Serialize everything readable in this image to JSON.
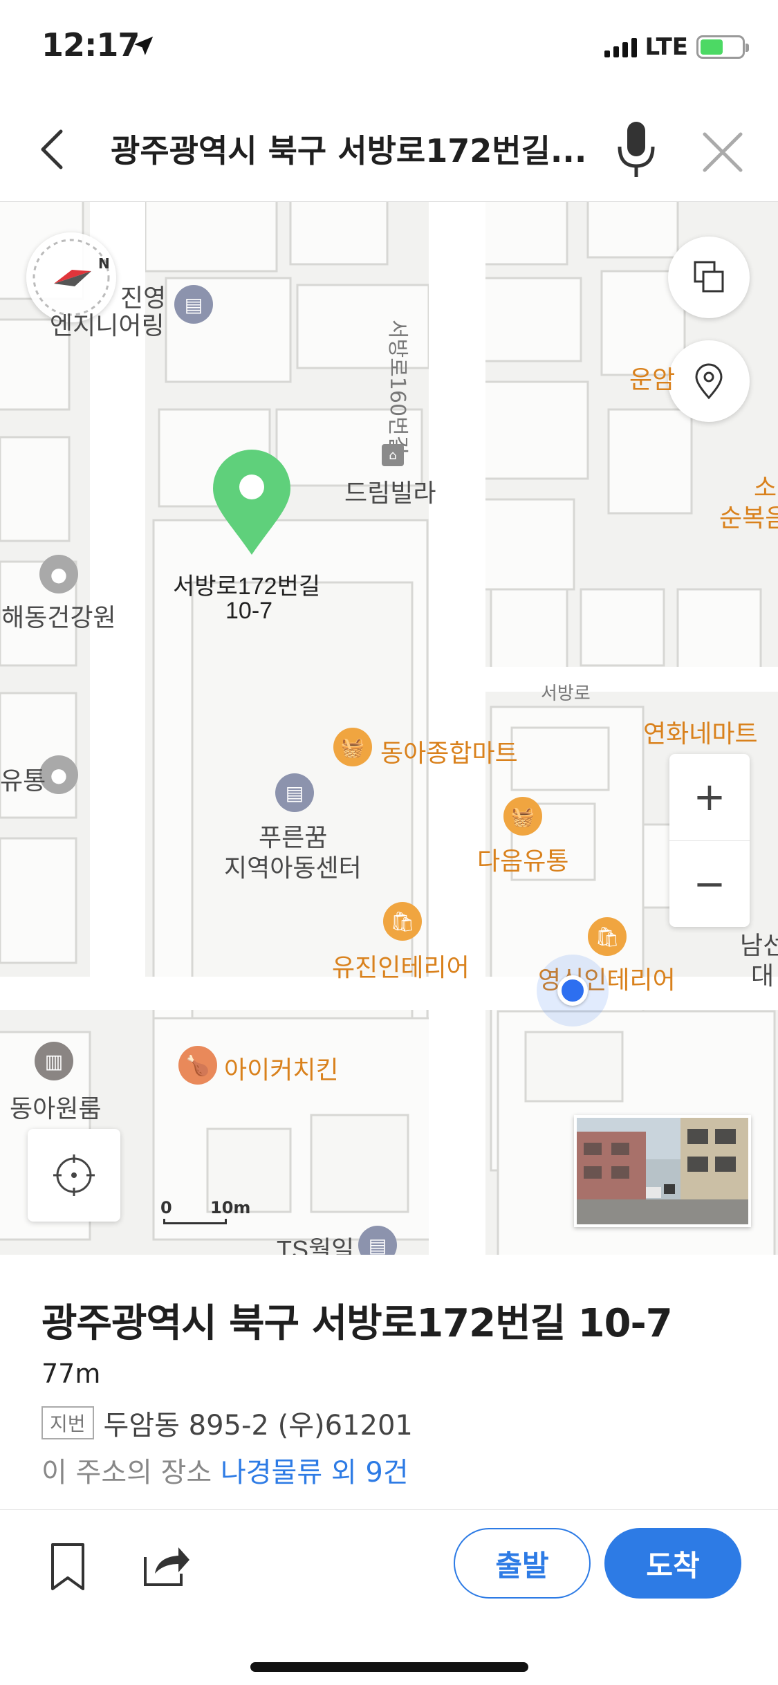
{
  "status_bar": {
    "time": "12:17",
    "network": "LTE",
    "battery_level": 0.56
  },
  "search": {
    "query": "광주광역시 북구 서방로172번길..."
  },
  "map": {
    "road_labels": {
      "vertical": "서방로160번길",
      "horizontal": "서방로"
    },
    "pois": {
      "jinyoung_line1": "진영",
      "jinyoung_line2": "엔지니어링",
      "dream_villa": "드림빌라",
      "haedong": "해동건강원",
      "yutong": "유통",
      "donga_mart": "동아종합마트",
      "pureun_line1": "푸른꿈",
      "pureun_line2": "지역아동센터",
      "daeum": "다음유통",
      "yujin": "유진인테리어",
      "yeongsin": "영신인테리어",
      "aikeo": "아이커치킨",
      "donga_room": "동아원룸",
      "ts": "TS월일",
      "yeonhwa": "연화네마트",
      "unam": "운암",
      "so": "소",
      "sunbok": "순복음",
      "namseon": "남선",
      "dae": "대"
    },
    "marker_label_line1": "서방로172번길",
    "marker_label_line2": "10-7",
    "scale": {
      "zero": "0",
      "distance": "10m"
    },
    "zoom_in_label": "+",
    "zoom_out_label": "−",
    "colors": {
      "marker": "#5fd07b",
      "my_location": "#2d6ff0",
      "poi_orange": "#f0a540",
      "poi_gray": "#9a9a9a"
    }
  },
  "place": {
    "title": "광주광역시 북구 서방로172번길 10-7",
    "distance": "77m",
    "jibun_badge": "지번",
    "jibun_value": "두암동 895-2 (우)61201",
    "places_prefix": "이 주소의 장소 ",
    "places_link": "나경물류 외 9건"
  },
  "actions": {
    "depart_label": "출발",
    "arrive_label": "도착",
    "accent": "#2d7be5"
  }
}
